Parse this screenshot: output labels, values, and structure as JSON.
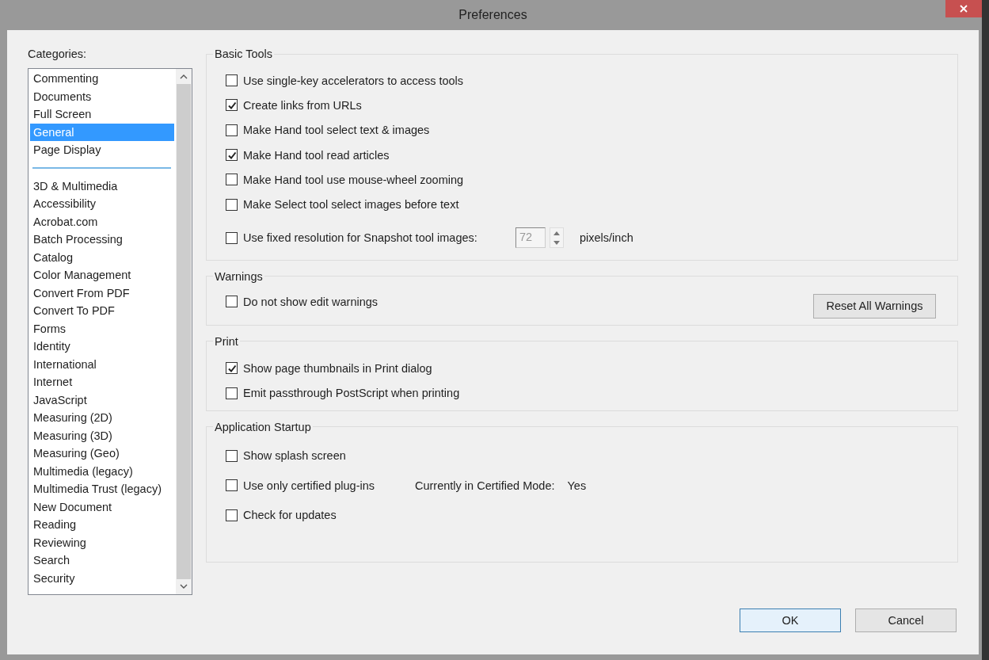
{
  "window": {
    "title": "Preferences"
  },
  "categories": {
    "label": "Categories:",
    "groups": [
      {
        "items": [
          {
            "label": "Commenting",
            "selected": false
          },
          {
            "label": "Documents",
            "selected": false
          },
          {
            "label": "Full Screen",
            "selected": false
          },
          {
            "label": "General",
            "selected": true
          },
          {
            "label": "Page Display",
            "selected": false
          }
        ]
      },
      {
        "items": [
          {
            "label": "3D & Multimedia",
            "selected": false
          },
          {
            "label": "Accessibility",
            "selected": false
          },
          {
            "label": "Acrobat.com",
            "selected": false
          },
          {
            "label": "Batch Processing",
            "selected": false
          },
          {
            "label": "Catalog",
            "selected": false
          },
          {
            "label": "Color Management",
            "selected": false
          },
          {
            "label": "Convert From PDF",
            "selected": false
          },
          {
            "label": "Convert To PDF",
            "selected": false
          },
          {
            "label": "Forms",
            "selected": false
          },
          {
            "label": "Identity",
            "selected": false
          },
          {
            "label": "International",
            "selected": false
          },
          {
            "label": "Internet",
            "selected": false
          },
          {
            "label": "JavaScript",
            "selected": false
          },
          {
            "label": "Measuring (2D)",
            "selected": false
          },
          {
            "label": "Measuring (3D)",
            "selected": false
          },
          {
            "label": "Measuring (Geo)",
            "selected": false
          },
          {
            "label": "Multimedia (legacy)",
            "selected": false
          },
          {
            "label": "Multimedia Trust (legacy)",
            "selected": false
          },
          {
            "label": "New Document",
            "selected": false
          },
          {
            "label": "Reading",
            "selected": false
          },
          {
            "label": "Reviewing",
            "selected": false
          },
          {
            "label": "Search",
            "selected": false
          },
          {
            "label": "Security",
            "selected": false
          }
        ]
      }
    ]
  },
  "sections": [
    {
      "title": "Basic Tools",
      "items": [
        {
          "kind": "checkbox",
          "label": "Use single-key accelerators to access tools",
          "checked": false
        },
        {
          "kind": "checkbox",
          "label": "Create links from URLs",
          "checked": true
        },
        {
          "kind": "checkbox",
          "label": "Make Hand tool select text & images",
          "checked": false
        },
        {
          "kind": "checkbox",
          "label": "Make Hand tool read articles",
          "checked": true
        },
        {
          "kind": "checkbox",
          "label": "Make Hand tool use mouse-wheel zooming",
          "checked": false
        },
        {
          "kind": "checkbox",
          "label": "Make Select tool select images before text",
          "checked": false
        },
        {
          "kind": "spin",
          "label": "Use fixed resolution for Snapshot tool images:",
          "checked": false,
          "value": "72",
          "disabled": true,
          "unit": "pixels/inch"
        }
      ]
    },
    {
      "title": "Warnings",
      "items": [
        {
          "kind": "checkbox",
          "label": "Do not show edit warnings",
          "checked": false
        }
      ],
      "button": "Reset All Warnings"
    },
    {
      "title": "Print",
      "items": [
        {
          "kind": "checkbox",
          "label": "Show page thumbnails in Print dialog",
          "checked": true
        },
        {
          "kind": "checkbox",
          "label": "Emit passthrough PostScript when printing",
          "checked": false
        }
      ]
    },
    {
      "title": "Application Startup",
      "items": [
        {
          "kind": "checkbox",
          "label": "Show splash screen",
          "checked": false
        },
        {
          "kind": "info",
          "label": "Use only certified plug-ins",
          "checked": false,
          "info_label": "Currently in Certified Mode:",
          "info_value": "Yes"
        },
        {
          "kind": "checkbox",
          "label": "Check for updates",
          "checked": false
        }
      ]
    }
  ],
  "buttons": [
    "OK",
    "Cancel"
  ]
}
